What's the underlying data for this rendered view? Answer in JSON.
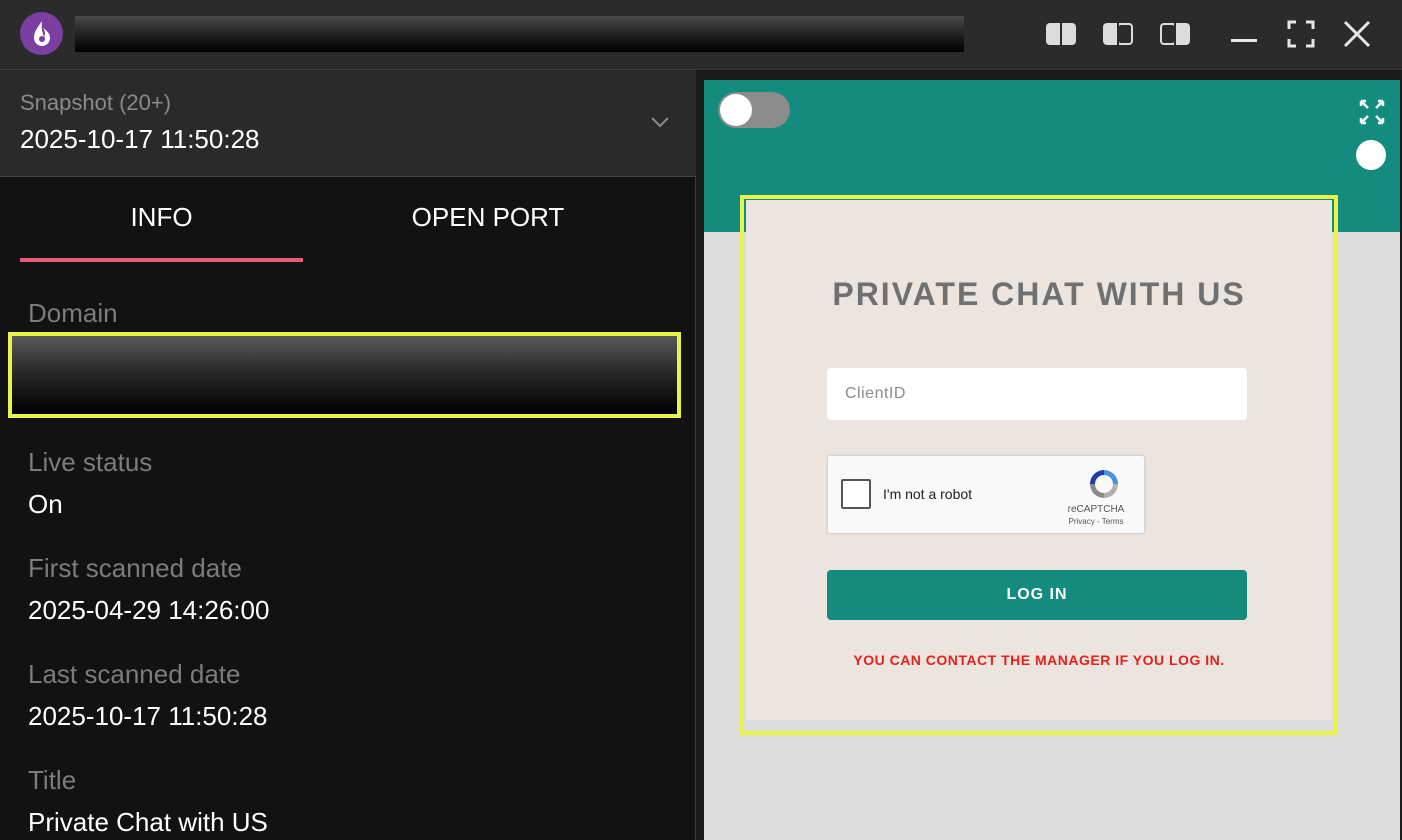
{
  "titlebar": {
    "icons": [
      "app-logo-icon",
      "layout-left-icon",
      "layout-split-icon",
      "layout-right-icon",
      "minimize-icon",
      "fullscreen-icon",
      "close-icon"
    ]
  },
  "snapshot": {
    "label": "Snapshot (20+)",
    "value": "2025-10-17 11:50:28"
  },
  "tabs": [
    {
      "label": "INFO",
      "active": true
    },
    {
      "label": "OPEN PORT",
      "active": false
    }
  ],
  "fields": {
    "domain_label": "Domain",
    "live_status_label": "Live status",
    "live_status_value": "On",
    "first_scanned_label": "First scanned date",
    "first_scanned_value": "2025-04-29 14:26:00",
    "last_scanned_label": "Last scanned date",
    "last_scanned_value": "2025-10-17 11:50:28",
    "title_label": "Title",
    "title_value": "Private Chat with US"
  },
  "preview": {
    "heading": "PRIVATE CHAT WITH US",
    "client_placeholder": "ClientID",
    "recaptcha_text": "I'm not a robot",
    "recaptcha_brand": "reCAPTCHA",
    "recaptcha_links": "Privacy - Terms",
    "login_label": "LOG IN",
    "notice": "YOU CAN CONTACT THE MANAGER IF YOU LOG IN."
  },
  "colors": {
    "accent_tab": "#e85a76",
    "highlight": "#e8f545",
    "teal": "#138b7e",
    "notice_red": "#e5211b"
  }
}
